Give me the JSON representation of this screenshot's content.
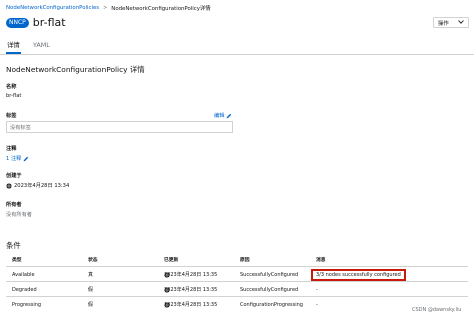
{
  "breadcrumb": {
    "parent": "NodeNetworkConfigurationPolicies",
    "separator": ">",
    "current": "NodeNetworkConfigurationPolicy详情"
  },
  "resource": {
    "badge": "NNCP",
    "name": "br-flat"
  },
  "actions_label": "操作",
  "tabs": [
    "详情",
    "YAML"
  ],
  "section_title": "NodeNetworkConfigurationPolicy 详情",
  "fields": {
    "name_label": "名称",
    "name_value": "br-flat",
    "labels_label": "标签",
    "edit_label": "编辑",
    "labels_empty": "没有标签",
    "annotations_label": "注释",
    "annotations_value": "1 注释",
    "created_label": "创建于",
    "created_value": "2023年4月28日 13:34",
    "owner_label": "所有者",
    "owner_value": "没有所有者"
  },
  "conditions": {
    "title": "条件",
    "headers": [
      "类型",
      "状态",
      "已更新",
      "原因",
      "消息"
    ],
    "rows": [
      {
        "type": "Available",
        "status": "真",
        "updated": "2023年4月28日 13:35",
        "reason": "SuccessfullyConfigured",
        "message": "3/3 nodes successfully configured"
      },
      {
        "type": "Degraded",
        "status": "假",
        "updated": "2023年4月28日 13:35",
        "reason": "SuccessfullyConfigured",
        "message": "-"
      },
      {
        "type": "Progressing",
        "status": "假",
        "updated": "2023年4月28日 13:35",
        "reason": "ConfigurationProgressing",
        "message": "-"
      }
    ]
  },
  "watermark": "CSDN @dawnsky.liu",
  "colors": {
    "link": "#0066cc",
    "badge": "#0066cc",
    "highlight_border": "#c9190b",
    "border": "#d2d2d2",
    "muted": "#6a6e73"
  },
  "icons": [
    "chevron-down-icon",
    "pencil-icon",
    "globe-icon"
  ]
}
